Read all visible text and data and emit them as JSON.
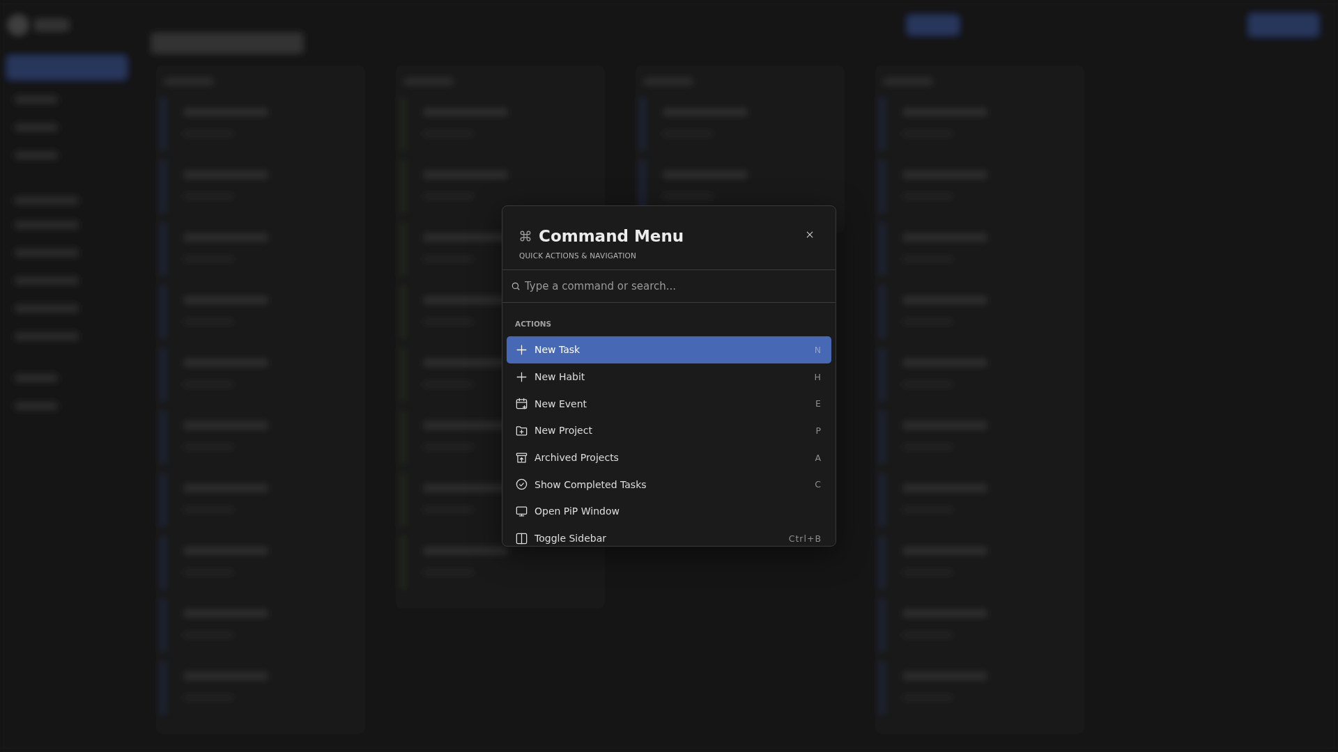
{
  "command_menu": {
    "title": "Command Menu",
    "subtitle": "QUICK ACTIONS & NAVIGATION",
    "search": {
      "placeholder": "Type a command or search..."
    },
    "sections": [
      {
        "heading": "ACTIONS",
        "items": [
          {
            "label": "New Task",
            "kind": "plus",
            "shortcut": "N",
            "selected": true
          },
          {
            "label": "New Habit",
            "kind": "plus",
            "shortcut": "H",
            "selected": false
          },
          {
            "label": "New Event",
            "kind": "calendar",
            "shortcut": "E",
            "selected": false
          },
          {
            "label": "New Project",
            "kind": "folder",
            "shortcut": "P",
            "selected": false
          },
          {
            "label": "Archived Projects",
            "kind": "archive",
            "shortcut": "A",
            "selected": false
          },
          {
            "label": "Show Completed Tasks",
            "kind": "check",
            "shortcut": "C",
            "selected": false
          },
          {
            "label": "Open PiP Window",
            "kind": "monitor",
            "selected": false
          },
          {
            "label": "Toggle Sidebar",
            "kind": "sidebar",
            "shortcut": "Ctrl+B",
            "selected": false
          }
        ]
      }
    ]
  }
}
